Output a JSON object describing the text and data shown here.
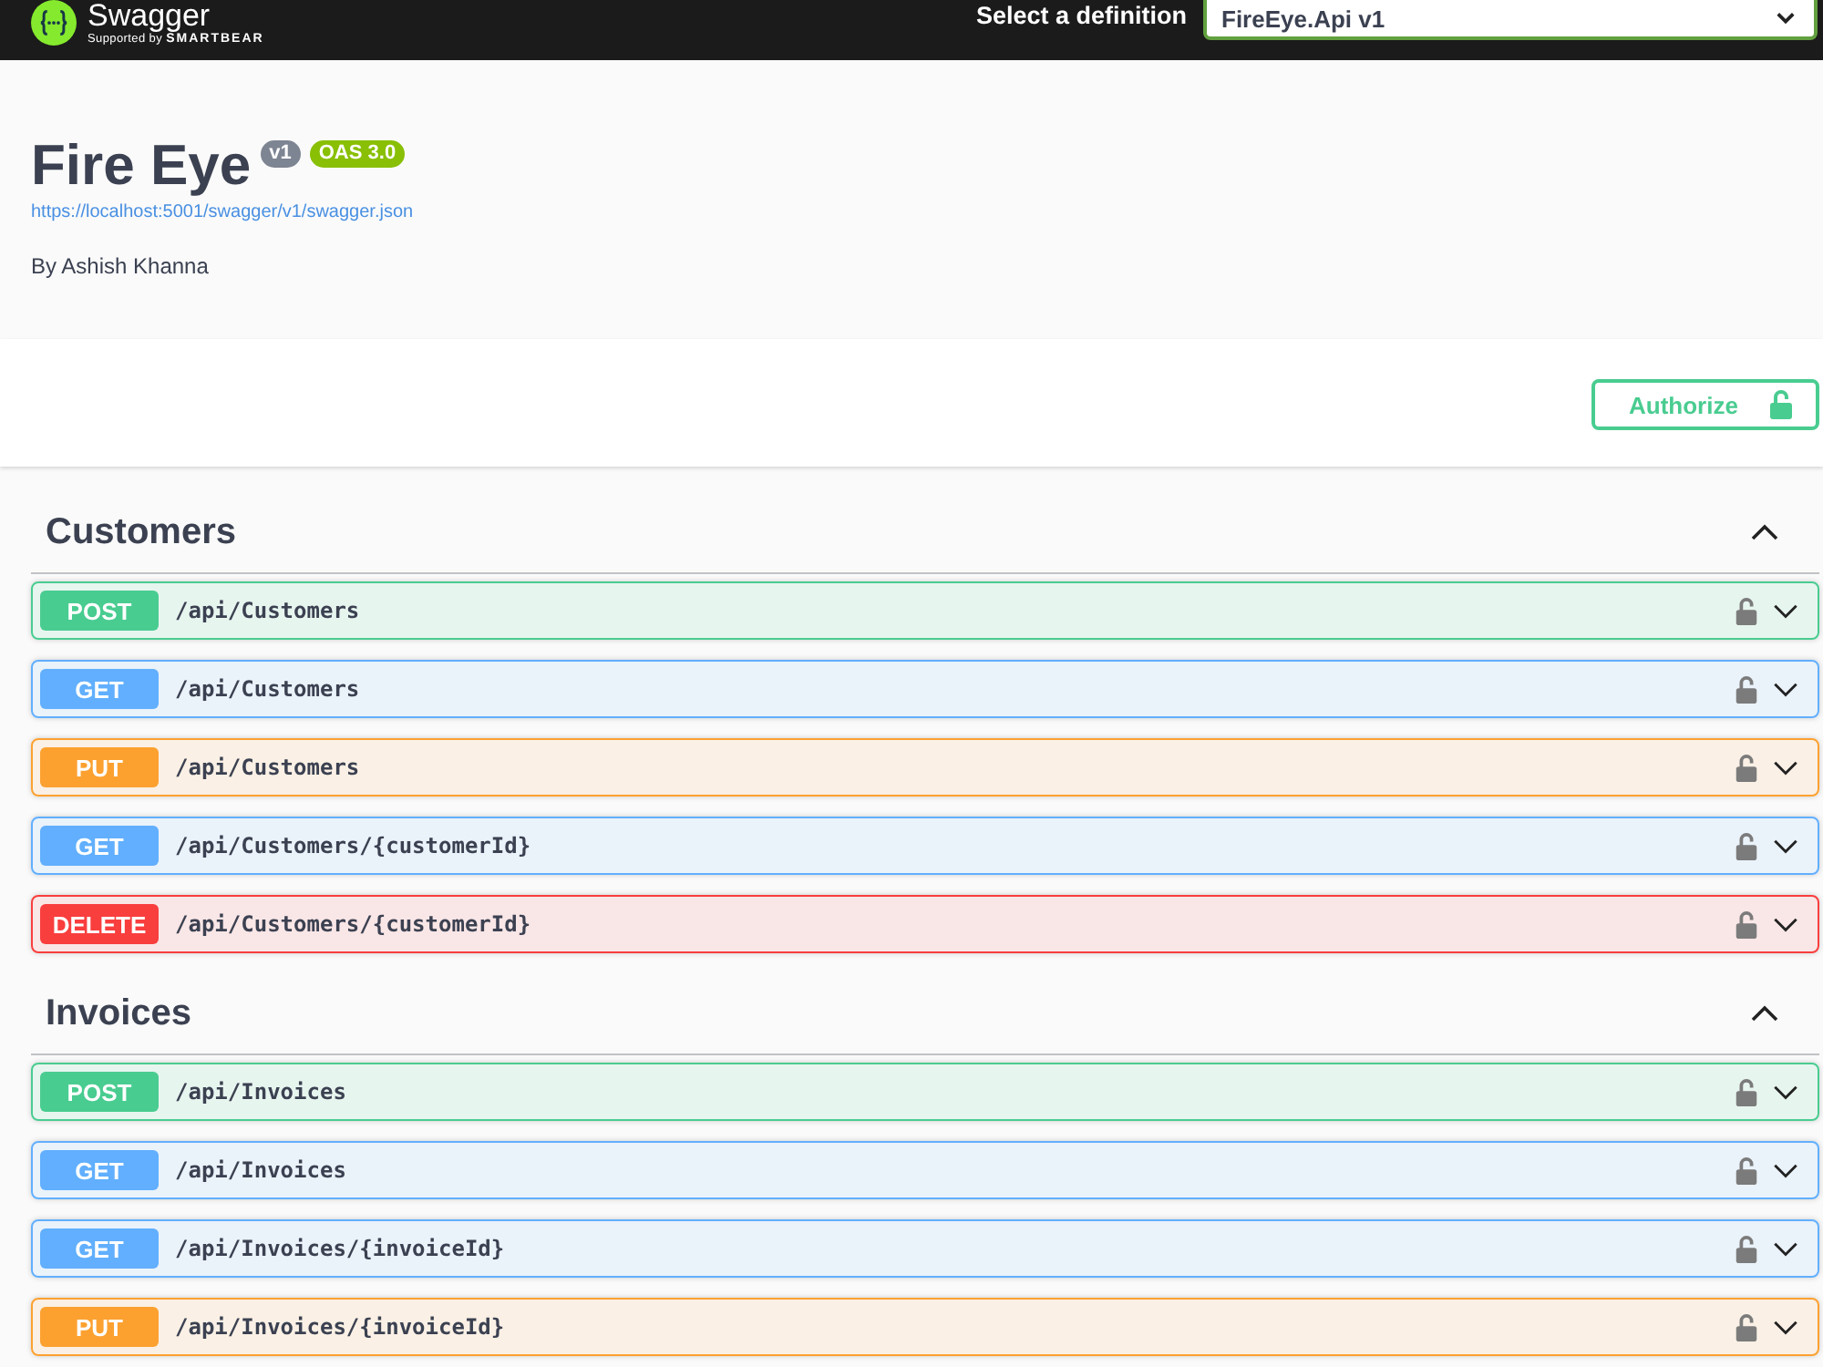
{
  "topbar": {
    "logo_text": "Swagger",
    "logo_tagline": "Supported by **SMARTBEAR**",
    "definition_label": "Select a definition",
    "definition_value": "FireEye.Api v1"
  },
  "info": {
    "title": "Fire Eye",
    "version_badge": "v1",
    "oas_badge": "OAS 3.0",
    "spec_url": "https://localhost:5001/swagger/v1/swagger.json",
    "author": "By Ashish Khanna"
  },
  "authorize_button": {
    "label": "Authorize",
    "authorized": false
  },
  "sections": [
    {
      "name": "Customers",
      "expanded": true,
      "operations": [
        {
          "kind": "post",
          "method": "POST",
          "path": "/api/Customers",
          "locked": false,
          "expanded": false
        },
        {
          "kind": "get",
          "method": "GET",
          "path": "/api/Customers",
          "locked": false,
          "expanded": false
        },
        {
          "kind": "put",
          "method": "PUT",
          "path": "/api/Customers",
          "locked": false,
          "expanded": false
        },
        {
          "kind": "get",
          "method": "GET",
          "path": "/api/Customers/{customerId}",
          "locked": false,
          "expanded": false
        },
        {
          "kind": "delete",
          "method": "DELETE",
          "path": "/api/Customers/{customerId}",
          "locked": false,
          "expanded": false
        }
      ]
    },
    {
      "name": "Invoices",
      "expanded": true,
      "operations": [
        {
          "kind": "post",
          "method": "POST",
          "path": "/api/Invoices",
          "locked": false,
          "expanded": false
        },
        {
          "kind": "get",
          "method": "GET",
          "path": "/api/Invoices",
          "locked": false,
          "expanded": false
        },
        {
          "kind": "get",
          "method": "GET",
          "path": "/api/Invoices/{invoiceId}",
          "locked": false,
          "expanded": false
        },
        {
          "kind": "put",
          "method": "PUT",
          "path": "/api/Invoices/{invoiceId}",
          "locked": false,
          "expanded": false
        }
      ]
    }
  ]
}
